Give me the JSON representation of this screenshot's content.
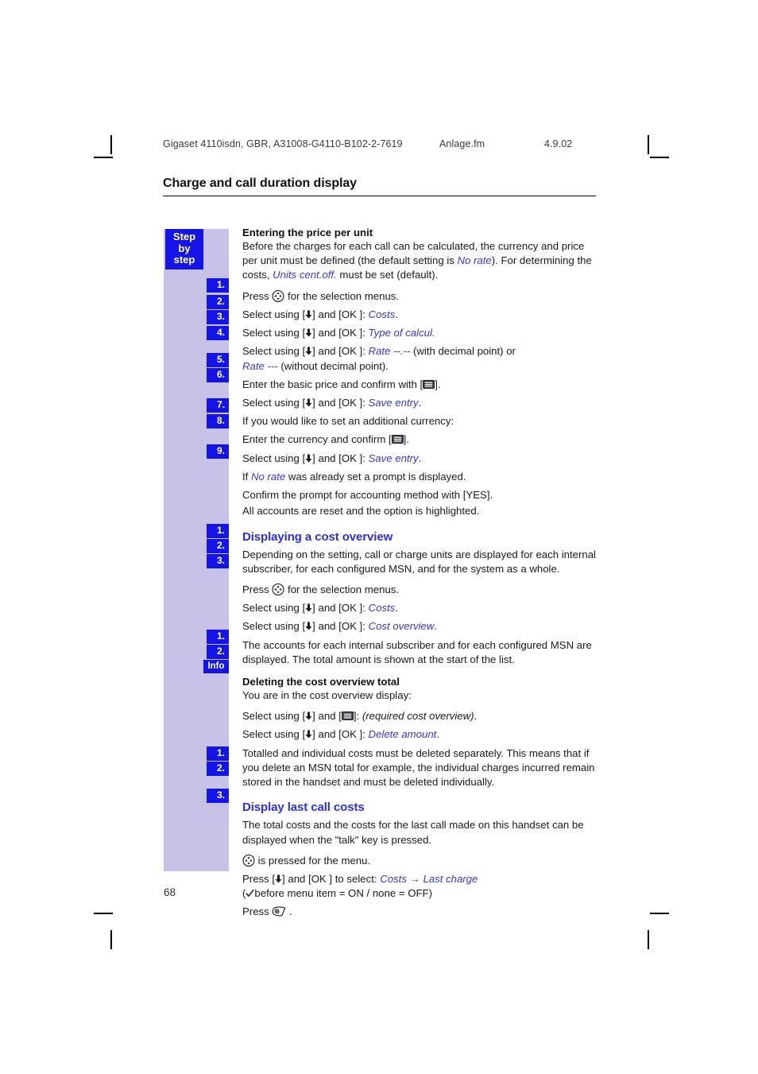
{
  "header": {
    "doc_id": "Gigaset 4110isdn, GBR, A31008-G4110-B102-2-7619",
    "file": "Anlage.fm",
    "date": "4.9.02"
  },
  "chapter_title": "Charge and call duration display",
  "sidebar": {
    "step_tag_line1": "Step",
    "step_tag_line2": "by",
    "step_tag_line3": "step",
    "info_label": "Info",
    "numbers": [
      "1.",
      "2.",
      "3.",
      "4.",
      "5.",
      "6.",
      "7.",
      "8.",
      "9."
    ]
  },
  "sections": {
    "entering_price": {
      "heading": "Entering the price per unit",
      "intro_a": "Before the charges for each call can be calculated, the currency and price per unit must be defined (the default setting is ",
      "intro_no_rate": "No rate",
      "intro_b": "). For determining the costs, ",
      "intro_units": "Units cent.off.",
      "intro_c": " must be set (default).",
      "step1_a": "Press ",
      "step1_b": " for the selection menus.",
      "step2_a": "Select using [",
      "step2_b": "] and [OK ]: ",
      "step2_item": "Costs",
      "step2_end": ".",
      "step3_item": "Type of calcul.",
      "step4_item_a": "Rate --.--",
      "step4_mid": " (with decimal point) or",
      "step4_item_b": "Rate ---",
      "step4_end": " (without decimal point).",
      "step5_a": "Enter the basic price and confirm with [",
      "step5_b": "].",
      "step6_item": "Save entry",
      "note_currency": "If you would like to set an additional currency:",
      "step7_a": "Enter the currency and confirm [",
      "step7_b": "].",
      "step8_item": "Save entry",
      "note_no_rate_a": "If ",
      "note_no_rate_b": "No rate",
      "note_no_rate_c": " was already set a prompt is displayed.",
      "step9": "Confirm the prompt for accounting method with [YES].",
      "after9": "All accounts are reset and the option is highlighted."
    },
    "cost_overview": {
      "heading": "Displaying a cost overview",
      "intro": "Depending on the setting, call or charge units are displayed for each internal subscriber, for each configured MSN, and for the system as a whole.",
      "step1_a": "Press ",
      "step1_b": " for the selection menus.",
      "step2_item": "Costs",
      "step3_item": "Cost overview",
      "after": "The accounts for each internal subscriber and for each configured MSN are displayed. The total amount is shown at the start of the list."
    },
    "deleting_total": {
      "heading": "Deleting the cost overview total",
      "intro": "You are in the cost overview display:",
      "step1_a": "Select using [",
      "step1_b": "] and [",
      "step1_c": "]: ",
      "step1_item": "(required cost overview)",
      "step1_end": ".",
      "step2_a": "Select using [",
      "step2_b": "] and [OK ]: ",
      "step2_item": "Delete amount",
      "step2_end": ".",
      "info_text": "Totalled and individual costs must be deleted separately. This means that if you delete an MSN total for example, the individual charges incurred remain stored in the handset and must be deleted individually."
    },
    "last_call_costs": {
      "heading": "Display last call costs",
      "intro": "The total costs and the costs for the last call made on this handset can be displayed when the \"talk\" key is pressed.",
      "step1_a": " is pressed for the menu.",
      "step2_a": "Press [",
      "step2_b": "] and [OK ] to select: ",
      "step2_item_a": "Costs",
      "step2_arrow": " → ",
      "step2_item_b": "Last charge",
      "step2_note_a": "(",
      "step2_note_b": "before menu item = ON / none = OFF)",
      "step3_a": "Press ",
      "step3_b": " ."
    }
  },
  "folio": "68",
  "colors": {
    "badge_blue": "#1414e6",
    "band_lavender": "#c9c2e8",
    "link_blue": "#3535ee",
    "heading_blue": "#2d2df0"
  }
}
